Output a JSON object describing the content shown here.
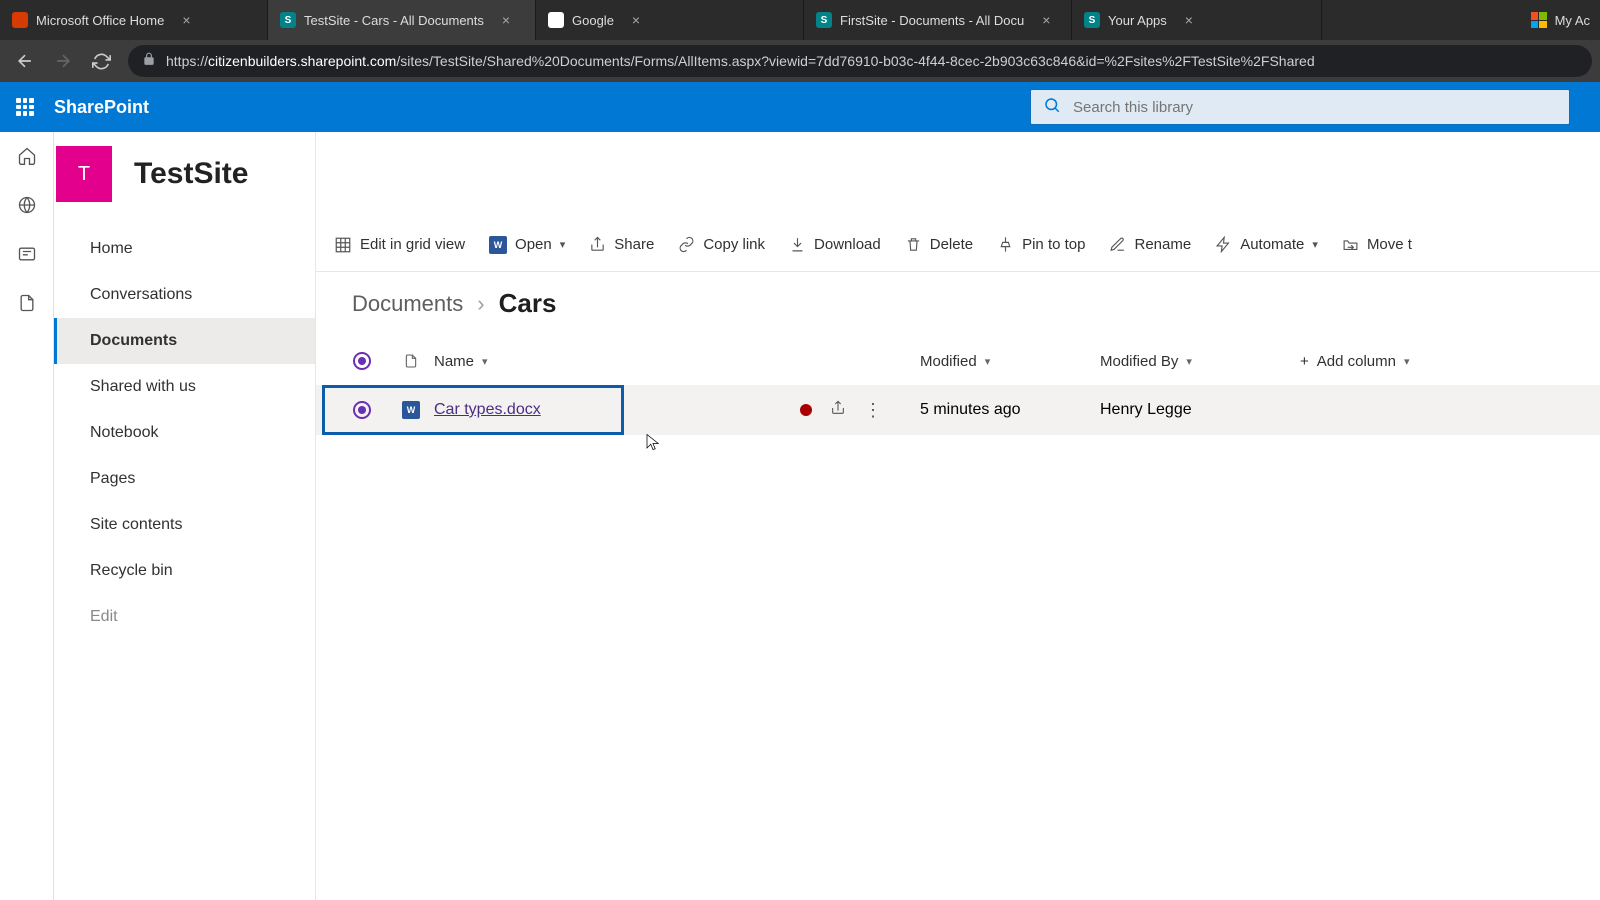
{
  "browser": {
    "tabs": [
      {
        "title": "Microsoft Office Home",
        "favicon": "#d83b01"
      },
      {
        "title": "TestSite - Cars - All Documents",
        "favicon": "#038387",
        "active": true
      },
      {
        "title": "Google",
        "favicon": "#ffffff"
      },
      {
        "title": "FirstSite - Documents - All Docu",
        "favicon": "#038387"
      },
      {
        "title": "Your Apps",
        "favicon": "#038387"
      }
    ],
    "more_tab": "My Ac",
    "url_host": "citizenbuilders.sharepoint.com",
    "url_path": "/sites/TestSite/Shared%20Documents/Forms/AllItems.aspx?viewid=7dd76910-b03c-4f44-8cec-2b903c63c846&id=%2Fsites%2FTestSite%2FShared"
  },
  "suite": {
    "app_name": "SharePoint",
    "search_placeholder": "Search this library"
  },
  "site": {
    "logo_initial": "T",
    "title": "TestSite",
    "nav": [
      "Home",
      "Conversations",
      "Documents",
      "Shared with us",
      "Notebook",
      "Pages",
      "Site contents",
      "Recycle bin",
      "Edit"
    ],
    "nav_active_index": 2
  },
  "commands": {
    "edit_grid": "Edit in grid view",
    "open": "Open",
    "share": "Share",
    "copy_link": "Copy link",
    "download": "Download",
    "delete": "Delete",
    "pin": "Pin to top",
    "rename": "Rename",
    "automate": "Automate",
    "move": "Move t"
  },
  "breadcrumb": {
    "root": "Documents",
    "leaf": "Cars"
  },
  "columns": {
    "name": "Name",
    "modified": "Modified",
    "modified_by": "Modified By",
    "add": "Add column"
  },
  "rows": [
    {
      "file": "Car types.docx",
      "modified": "5 minutes ago",
      "modified_by": "Henry Legge",
      "selected": true
    }
  ]
}
